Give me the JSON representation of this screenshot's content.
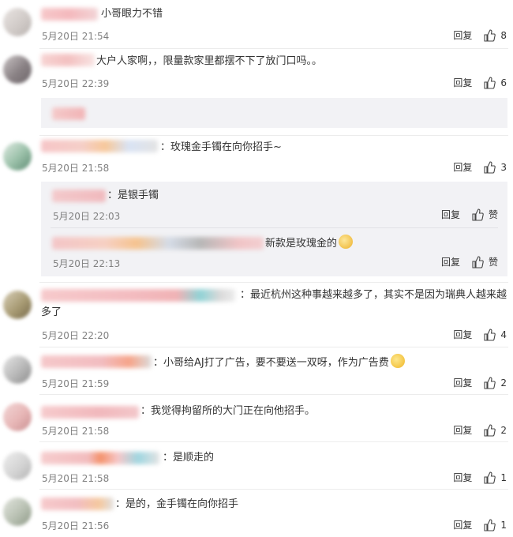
{
  "reply_label": "回复",
  "like_label": "赞",
  "colors": {
    "background": "#ffffff",
    "sub_background": "#f2f2f5",
    "time": "#808080",
    "text": "#333333"
  },
  "comments": [
    {
      "text": "小哥眼力不错",
      "time": "5月20日 21:54",
      "likes": "8"
    },
    {
      "text": "大户人家啊，，限量款家里都摆不下了放门口吗。。",
      "time": "5月20日 22:39",
      "likes": "6"
    },
    {
      "text": "：玫瑰金手镯在向你招手~",
      "time": "5月20日 21:58",
      "likes": "3",
      "replies": [
        {
          "text": "：是银手镯",
          "time": "5月20日 22:03"
        },
        {
          "text": "新款是玫瑰金的",
          "time": "5月20日 22:13"
        }
      ]
    },
    {
      "text": "：最近杭州这种事越来越多了，其实不是因为瑞典人越来越多了",
      "time": "5月20日 22:20",
      "likes": "4"
    },
    {
      "text": "：小哥给AJ打了广告，要不要送一双呀，作为广告费",
      "time": "5月20日 21:59",
      "likes": "2"
    },
    {
      "text": "：我觉得拘留所的大门正在向他招手。",
      "time": "5月20日 21:58",
      "likes": "2"
    },
    {
      "text": "：是顺走的",
      "time": "5月20日 21:58",
      "likes": "1"
    },
    {
      "text": "：是的，金手镯在向你招手",
      "time": "5月20日 21:56",
      "likes": "1"
    }
  ]
}
